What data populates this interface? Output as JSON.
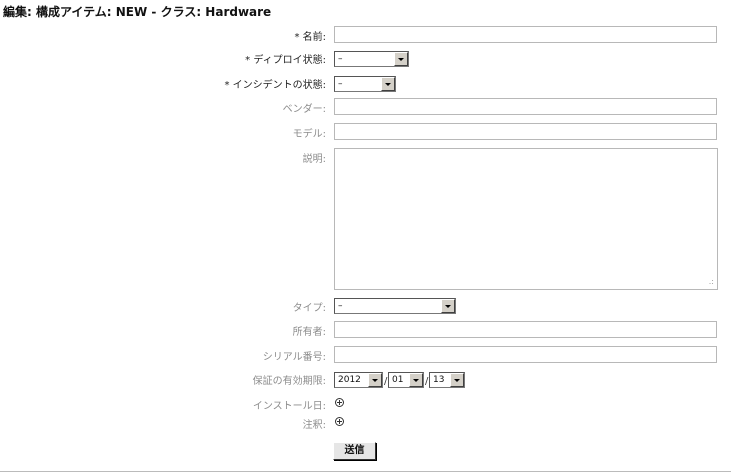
{
  "header": {
    "title": "編集: 構成アイテム: NEW - クラス: Hardware"
  },
  "form": {
    "name": {
      "label": "* 名前:",
      "value": ""
    },
    "deploy_state": {
      "label": "* ディプロイ状態:",
      "selected": "–"
    },
    "incident_state": {
      "label": "* インシデントの状態:",
      "selected": "–"
    },
    "vendor": {
      "label": "ベンダー:",
      "value": ""
    },
    "model": {
      "label": "モデル:",
      "value": ""
    },
    "description": {
      "label": "説明:",
      "value": "",
      "resize_glyph": ".:"
    },
    "type": {
      "label": "タイプ:",
      "selected": "–"
    },
    "owner": {
      "label": "所有者:",
      "value": ""
    },
    "serial": {
      "label": "シリアル番号:",
      "value": ""
    },
    "warranty": {
      "label": "保証の有効期限:",
      "year": "2012",
      "month": "01",
      "day": "13",
      "separator": "/"
    },
    "install_date": {
      "label": "インストール日:",
      "icon": "plus-circle-icon"
    },
    "notes": {
      "label": "注釈:",
      "icon": "plus-circle-icon"
    },
    "submit_label": "送信"
  }
}
